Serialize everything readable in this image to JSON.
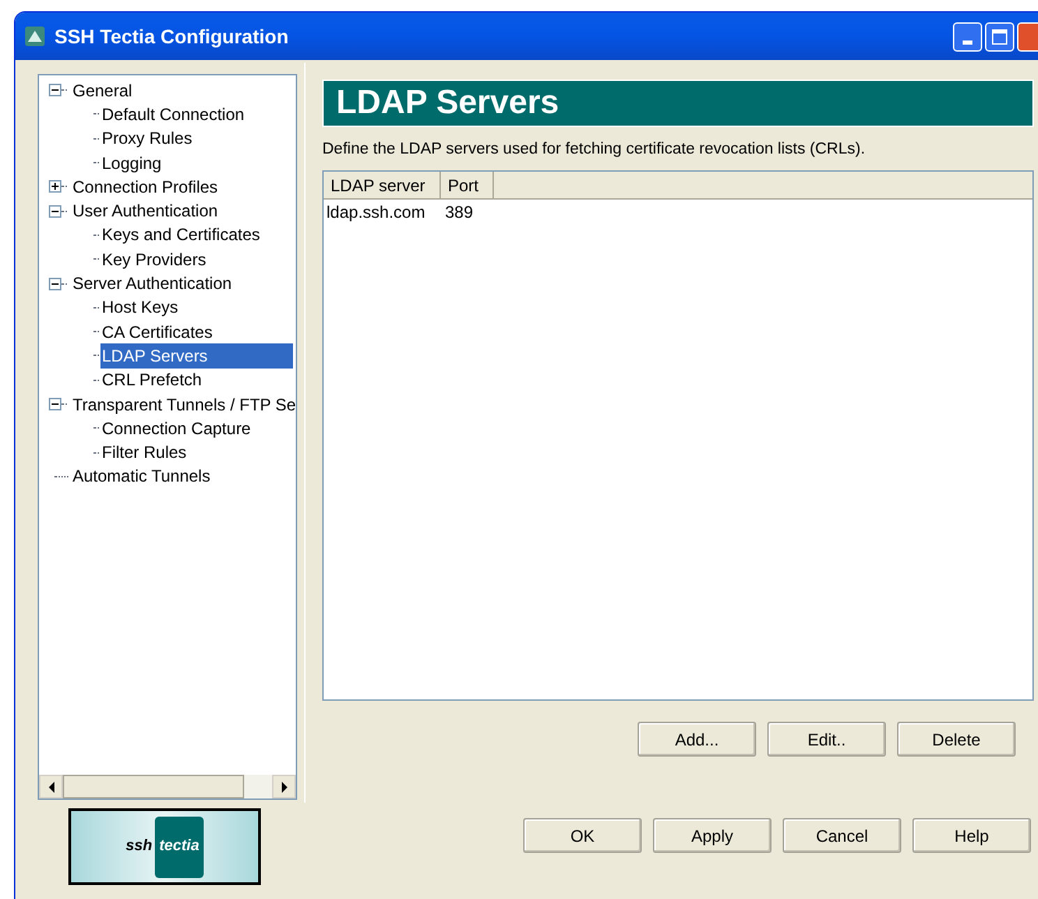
{
  "window": {
    "title": "SSH Tectia Configuration"
  },
  "tree": [
    {
      "label": "General",
      "expanded": true,
      "selected": false,
      "children": [
        {
          "label": "Default Connection",
          "selected": false
        },
        {
          "label": "Proxy Rules",
          "selected": false
        },
        {
          "label": "Logging",
          "selected": false
        }
      ]
    },
    {
      "label": "Connection Profiles",
      "expanded": false,
      "selected": false
    },
    {
      "label": "User Authentication",
      "expanded": true,
      "selected": false,
      "children": [
        {
          "label": "Keys and Certificates",
          "selected": false
        },
        {
          "label": "Key Providers",
          "selected": false
        }
      ]
    },
    {
      "label": "Server Authentication",
      "expanded": true,
      "selected": false,
      "children": [
        {
          "label": "Host Keys",
          "selected": false
        },
        {
          "label": "CA Certificates",
          "selected": false
        },
        {
          "label": "LDAP Servers",
          "selected": true
        },
        {
          "label": "CRL Prefetch",
          "selected": false
        }
      ]
    },
    {
      "label": "Transparent Tunnels / FTP Se",
      "expanded": true,
      "selected": false,
      "children": [
        {
          "label": "Connection Capture",
          "selected": false
        },
        {
          "label": "Filter Rules",
          "selected": false
        }
      ]
    },
    {
      "label": "Automatic Tunnels",
      "selected": false
    }
  ],
  "logo": {
    "left": "ssh",
    "right": "tectia"
  },
  "panel": {
    "title": "LDAP Servers",
    "description": "Define the LDAP servers used for fetching certificate revocation lists (CRLs).",
    "table": {
      "columns": [
        "LDAP server",
        "Port"
      ],
      "rows": [
        [
          "ldap.ssh.com",
          "389"
        ]
      ]
    },
    "buttons": [
      "Add...",
      "Edit..",
      "Delete"
    ]
  },
  "buttons": [
    "OK",
    "Apply",
    "Cancel",
    "Help"
  ]
}
